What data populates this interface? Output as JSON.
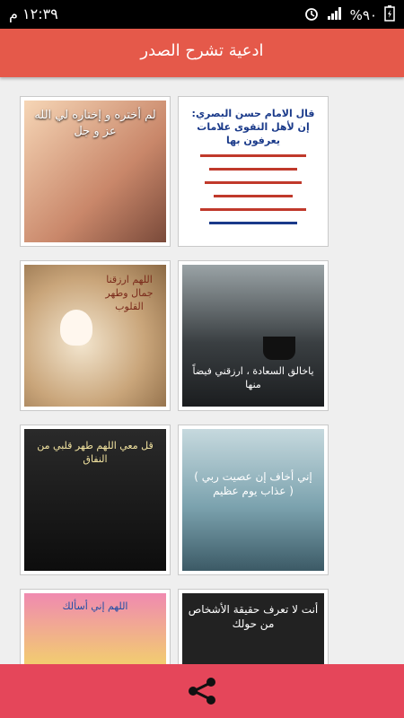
{
  "status_bar": {
    "time": "١٢:٣٩ م",
    "battery": "%٩٠"
  },
  "app_bar": {
    "title": "ادعية تشرح الصدر"
  },
  "cards": [
    {
      "caption": "قال الامام حسن البصري: إن لأهل التقوى علامات يعرفون بها"
    },
    {
      "caption": "لم أختره و إختاره لي الله عز و جل"
    },
    {
      "caption": "ياخالق السعادة ، ارزقني فيضاً منها"
    },
    {
      "caption": "اللهم ارزقنا جمال وطهر القلوب"
    },
    {
      "caption": "( إني أخاف إن عصيت ربي عذاب يوم عظيم )"
    },
    {
      "caption": "قل معي اللهم طهر قلبي من النفاق"
    },
    {
      "caption": "أنت لا تعرف حقيقة الأشخاص من حولك"
    },
    {
      "caption": "اللهم إني أسألك"
    }
  ],
  "icons": {
    "share": "share-icon",
    "signal": "signal-icon",
    "alarm": "alarm-icon",
    "battery": "battery-icon"
  },
  "colors": {
    "app_bar": "#e5594a",
    "bottom_bar": "#e5465a"
  }
}
